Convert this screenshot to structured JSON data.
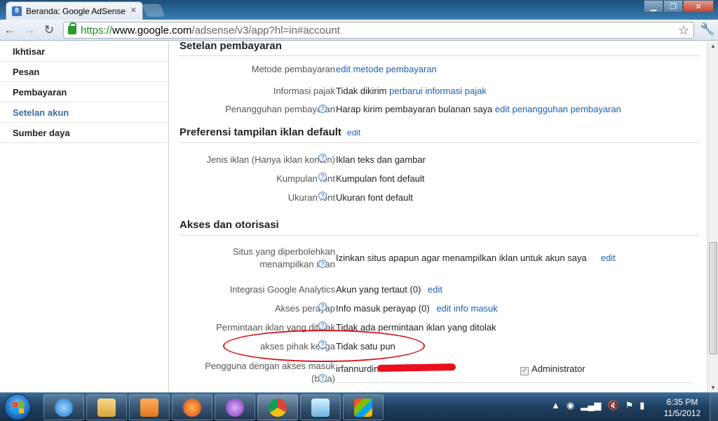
{
  "browser": {
    "tab_title": "Beranda: Google AdSense",
    "favicon_letter": "8",
    "url_scheme": "https://",
    "url_host": "www.google.com",
    "url_rest": "/adsense/v3/app?hl=in#account"
  },
  "sidebar": {
    "items": [
      {
        "label": "Ikhtisar"
      },
      {
        "label": "Pesan"
      },
      {
        "label": "Pembayaran"
      },
      {
        "label": "Setelan akun"
      },
      {
        "label": "Sumber daya"
      }
    ]
  },
  "payment": {
    "title": "Setelan pembayaran",
    "metode_label": "Metode pembayaran",
    "metode_link": "edit metode pembayaran",
    "pajak_label": "Informasi pajak",
    "pajak_value": "Tidak dikirim",
    "pajak_link": "perbarui informasi pajak",
    "penangguhan_label": "Penangguhan pembayaran",
    "penangguhan_value": "Harap kirim pembayaran bulanan saya",
    "penangguhan_link": "edit penangguhan pembayaran"
  },
  "ad_prefs": {
    "title": "Preferensi tampilan iklan default",
    "edit_link": "edit",
    "jenis_label": "Jenis iklan (Hanya iklan konten)",
    "jenis_value": "Iklan teks dan gambar",
    "kumpulan_label": "Kumpulan font",
    "kumpulan_value": "Kumpulan font default",
    "ukuran_label": "Ukuran font",
    "ukuran_value": "Ukuran font default"
  },
  "access": {
    "title": "Akses dan otorisasi",
    "situs_label_1": "Situs yang diperbolehkan",
    "situs_label_2": "menampilkan iklan",
    "situs_value": "Izinkan situs apapun agar menampilkan iklan untuk akun saya",
    "situs_link": "edit",
    "analytics_label": "Integrasi Google Analytics",
    "analytics_value": "Akun yang tertaut (0)",
    "analytics_link": "edit",
    "perayap_label": "Akses perayap",
    "perayap_value": "Info masuk perayap (0)",
    "perayap_link": "edit info masuk",
    "permintaan_label": "Permintaan iklan yang ditolak",
    "permintaan_value": "Tidak ada permintaan iklan yang ditolak",
    "pihak_label": "akses pihak ketiga",
    "pihak_value": "Tidak satu pun",
    "pengguna_label_1": "Pengguna dengan akses masuk",
    "pengguna_label_2": "(beta)",
    "pengguna_value": "irfannurdin",
    "pengguna_role": "Administrator"
  },
  "taskbar": {
    "time": "6:35 PM",
    "date": "11/5/2012"
  },
  "colors": {
    "link": "#1a5fb4",
    "annotation_red": "#d8141c"
  }
}
